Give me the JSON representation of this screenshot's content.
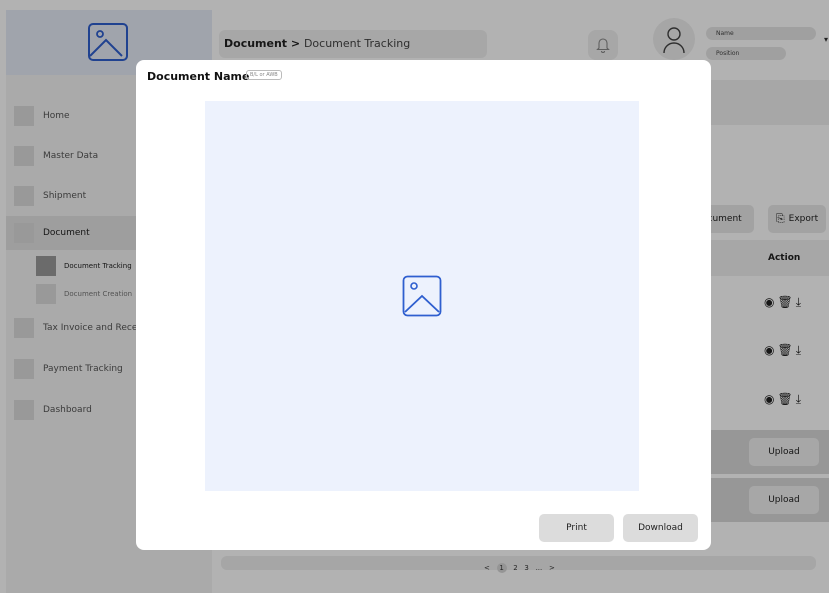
{
  "sidebar": {
    "items": [
      {
        "label": "Home"
      },
      {
        "label": "Master Data"
      },
      {
        "label": "Shipment"
      },
      {
        "label": "Document"
      },
      {
        "label": "Tax Invoice and Receipt"
      },
      {
        "label": "Payment Tracking"
      },
      {
        "label": "Dashboard"
      }
    ],
    "subitems": [
      {
        "label": "Document Tracking"
      },
      {
        "label": "Document Creation"
      }
    ]
  },
  "header": {
    "breadcrumb_parent": "Document",
    "breadcrumb_separator": " > ",
    "breadcrumb_current": "Document Tracking",
    "user_name": "Name",
    "user_position": "Position"
  },
  "background": {
    "document_button": "ocument",
    "export_button": "Export",
    "action_header": "Action",
    "upload_button": "Upload",
    "pager": {
      "prev": "<",
      "pages": [
        "1",
        "2",
        "3"
      ],
      "current": "1",
      "ellipsis": "...",
      "next": ">"
    }
  },
  "modal": {
    "title": "Document Name",
    "subtitle": "B/L or AWB",
    "print_button": "Print",
    "download_button": "Download"
  },
  "colors": {
    "accent": "#2f5fcf",
    "preview_bg": "#edf2fd",
    "overlay": "rgba(0,0,0,0.30)"
  }
}
